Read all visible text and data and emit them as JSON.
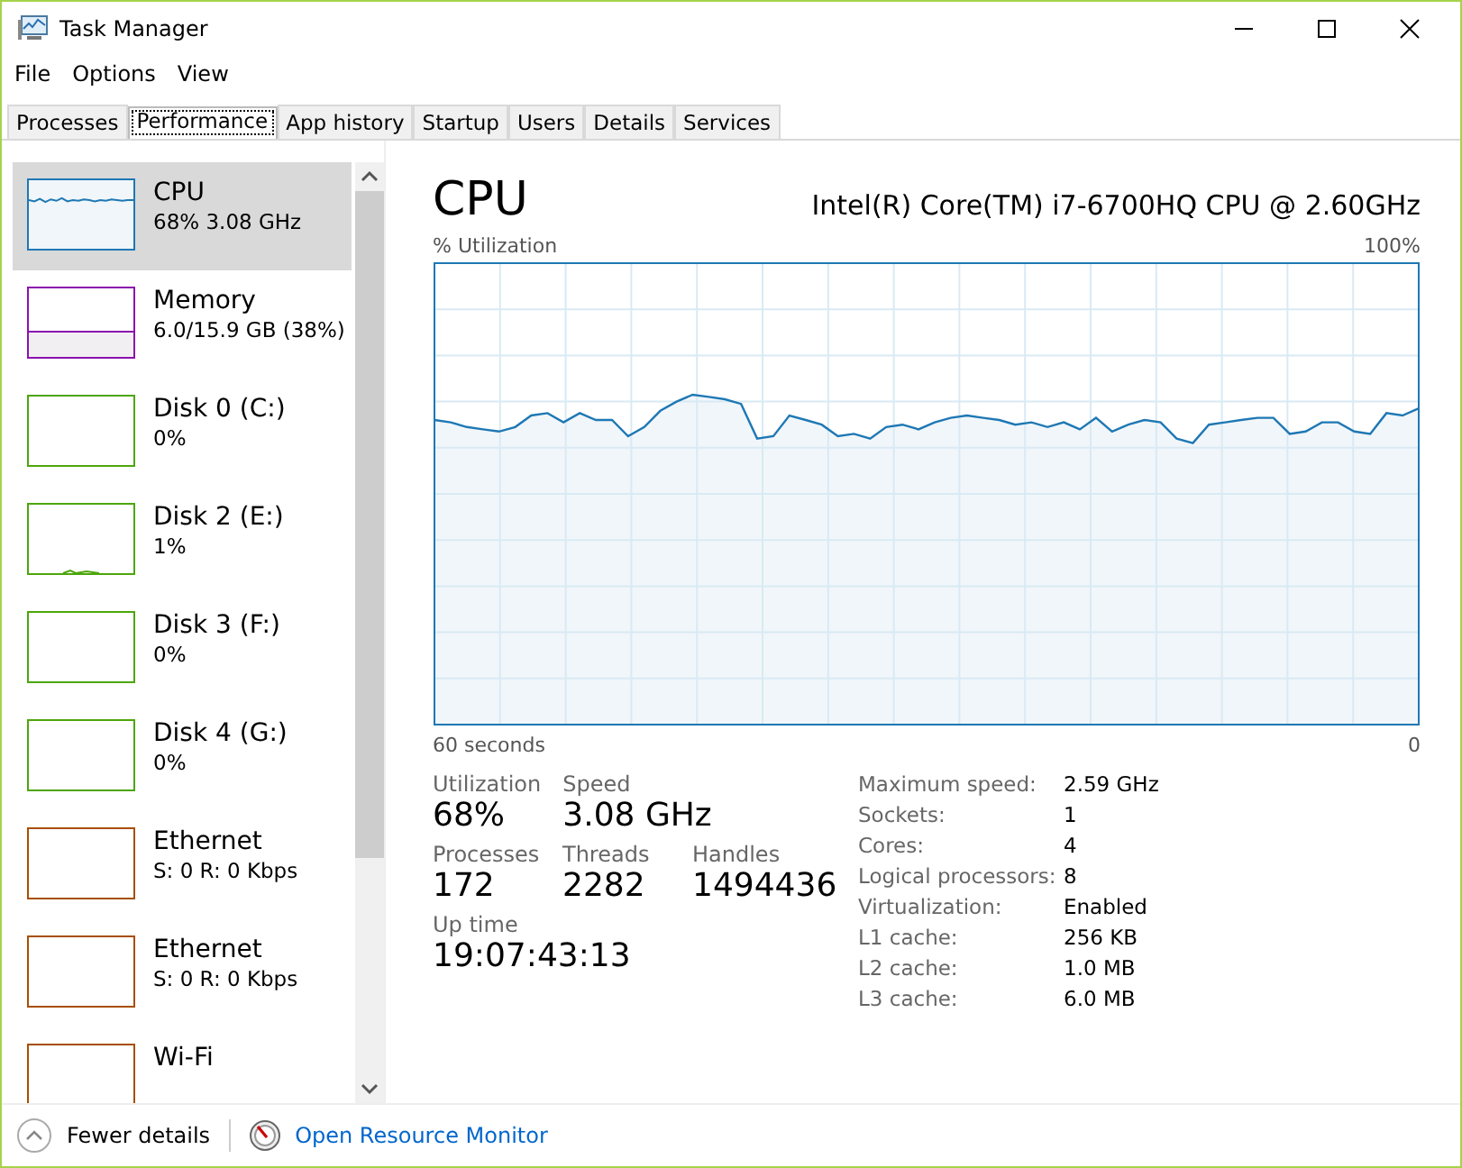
{
  "window": {
    "title": "Task Manager"
  },
  "menu": [
    "File",
    "Options",
    "View"
  ],
  "tabs": [
    {
      "label": "Processes",
      "selected": false
    },
    {
      "label": "Performance",
      "selected": true
    },
    {
      "label": "App history",
      "selected": false
    },
    {
      "label": "Startup",
      "selected": false
    },
    {
      "label": "Users",
      "selected": false
    },
    {
      "label": "Details",
      "selected": false
    },
    {
      "label": "Services",
      "selected": false
    }
  ],
  "sidebar": {
    "items": [
      {
        "kind": "cpu",
        "name": "CPU",
        "detail": "68% 3.08 GHz",
        "color": "#1e78b4",
        "selected": true
      },
      {
        "kind": "memory",
        "name": "Memory",
        "detail": "6.0/15.9 GB (38%)",
        "color": "#8b12ae",
        "selected": false
      },
      {
        "kind": "disk",
        "name": "Disk 0 (C:)",
        "detail": "0%",
        "color": "#4da60c",
        "selected": false
      },
      {
        "kind": "disk",
        "name": "Disk 2 (E:)",
        "detail": "1%",
        "color": "#4da60c",
        "selected": false
      },
      {
        "kind": "disk",
        "name": "Disk 3 (F:)",
        "detail": "0%",
        "color": "#4da60c",
        "selected": false
      },
      {
        "kind": "disk",
        "name": "Disk 4 (G:)",
        "detail": "0%",
        "color": "#4da60c",
        "selected": false
      },
      {
        "kind": "net",
        "name": "Ethernet",
        "detail": "S: 0 R: 0 Kbps",
        "color": "#a74f01",
        "selected": false
      },
      {
        "kind": "net",
        "name": "Ethernet",
        "detail": "S: 0 R: 0 Kbps",
        "color": "#a74f01",
        "selected": false
      },
      {
        "kind": "net",
        "name": "Wi-Fi",
        "color": "#a74f01",
        "selected": false
      }
    ]
  },
  "panel": {
    "title": "CPU",
    "model": "Intel(R) Core(TM) i7-6700HQ CPU @ 2.60GHz",
    "graph": {
      "ylabel": "% Utilization",
      "scale_max": "100%",
      "x_start": "60 seconds",
      "x_end": "0"
    },
    "stats": [
      {
        "label": "Utilization",
        "value": "68%"
      },
      {
        "label": "Speed",
        "value": "3.08 GHz"
      },
      {
        "label": "Processes",
        "value": "172"
      },
      {
        "label": "Threads",
        "value": "2282"
      },
      {
        "label": "Handles",
        "value": "1494436"
      },
      {
        "label": "Up time",
        "value": "19:07:43:13"
      }
    ],
    "specs": [
      {
        "label": "Maximum speed:",
        "value": "2.59 GHz"
      },
      {
        "label": "Sockets:",
        "value": "1"
      },
      {
        "label": "Cores:",
        "value": "4"
      },
      {
        "label": "Logical processors:",
        "value": "8"
      },
      {
        "label": "Virtualization:",
        "value": "Enabled"
      },
      {
        "label": "L1 cache:",
        "value": "256 KB"
      },
      {
        "label": "L2 cache:",
        "value": "1.0 MB"
      },
      {
        "label": "L3 cache:",
        "value": "6.0 MB"
      }
    ]
  },
  "footer": {
    "toggle": "Fewer details",
    "link": "Open Resource Monitor"
  }
}
